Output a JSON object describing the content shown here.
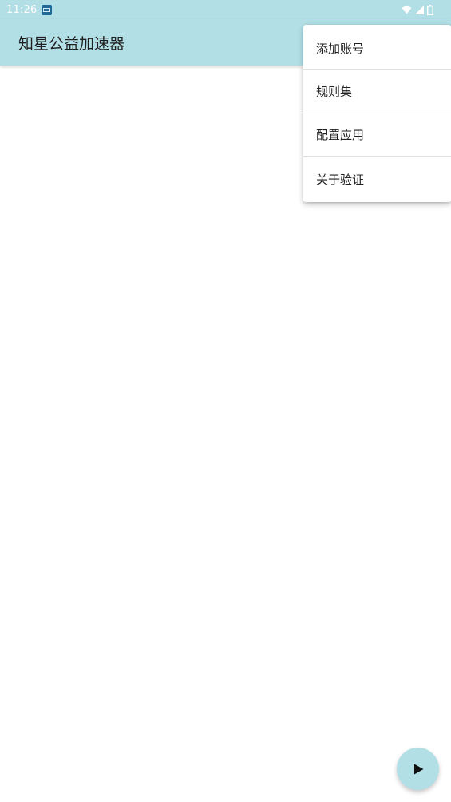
{
  "status_bar": {
    "time": "11:26",
    "notification_icon": "app-notification-icon",
    "wifi_icon": "wifi-icon",
    "signal_icon": "cell-signal-icon",
    "battery_icon": "battery-icon"
  },
  "app_bar": {
    "title": "知星公益加速器"
  },
  "menu": {
    "items": [
      {
        "label": "添加账号"
      },
      {
        "label": "规则集"
      },
      {
        "label": "配置应用"
      },
      {
        "label": "关于验证"
      }
    ]
  },
  "fab": {
    "icon": "play-icon"
  },
  "colors": {
    "primary": "#b2dfe6",
    "status_notification": "#1f6a99",
    "text": "#212121",
    "divider": "#e0e0e0",
    "background": "#ffffff"
  }
}
